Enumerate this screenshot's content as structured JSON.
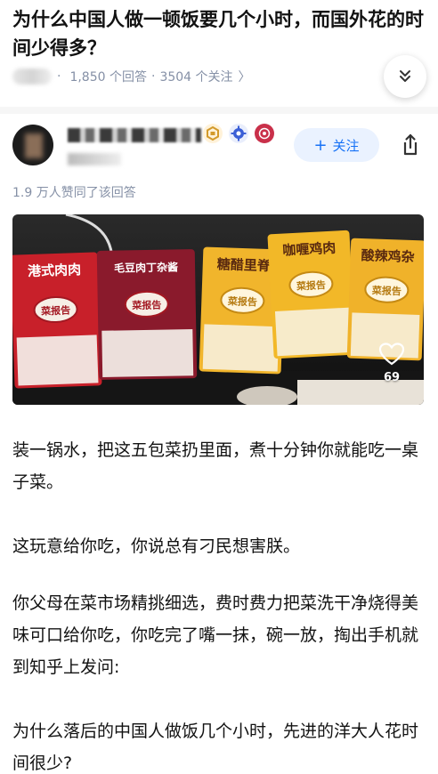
{
  "question": {
    "title": "为什么中国人做一顿饭要几个小时，而国外花的时间少得多？",
    "answers": "1,850 个回答",
    "followers": "3504 个关注",
    "sep": "·",
    "chevron": "〉"
  },
  "author": {
    "follow_label": "关注",
    "follow_plus": "+",
    "badges": [
      "level-badge-icon",
      "gear-badge-icon",
      "brand-badge-icon"
    ]
  },
  "answer": {
    "likes_text": "1.9 万人赞同了该回答",
    "photo_like_count": "69",
    "packages": [
      "港式肉肉",
      "毛豆肉丁杂酱",
      "糖醋里脊",
      "咖喱鸡肉",
      "酸辣鸡杂"
    ],
    "brand": "菜报告",
    "package_colors": [
      "#c8202a",
      "#8a1a2c",
      "#f1b52c",
      "#f2b828",
      "#f0b22a"
    ],
    "paragraphs": [
      "装一锅水，把这五包菜扔里面，煮十分钟你就能吃一桌子菜。",
      "这玩意给你吃，你说总有刁民想害朕。",
      "你父母在菜市场精挑细选，费时费力把菜洗干净烧得美味可口给你吃，你吃完了嘴一抹，碗一放，掏出手机就到知乎上发问:",
      "为什么落后的中国人做饭几个小时，先进的洋大人花时间很少?"
    ]
  },
  "colors": {
    "accent": "#1772f6",
    "meta_gray": "#8590a6"
  }
}
